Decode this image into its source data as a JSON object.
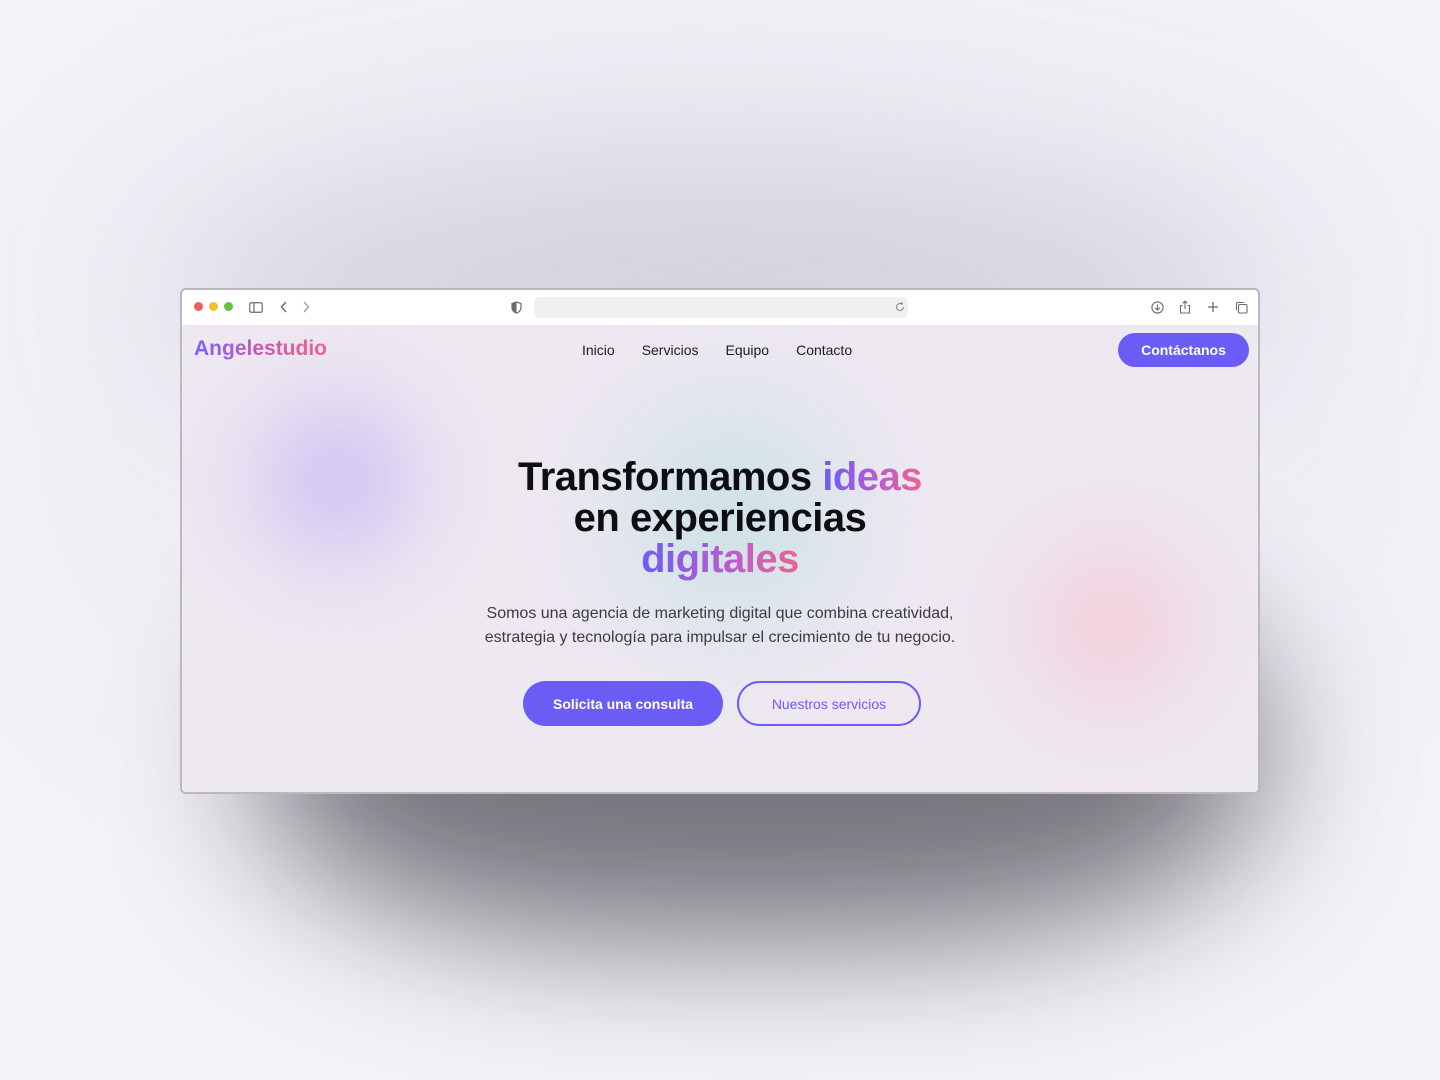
{
  "browser": {
    "url": ""
  },
  "site": {
    "logo": "Angelestudio",
    "nav": [
      "Inicio",
      "Servicios",
      "Equipo",
      "Contacto"
    ],
    "cta": "Contáctanos"
  },
  "hero": {
    "line1_a": "Transformamos ",
    "line1_b": "ideas",
    "line2": "en experiencias",
    "line3": "digitales",
    "subtitle_1": "Somos una agencia de marketing digital que combina creatividad,",
    "subtitle_2": "estrategia y tecnología para impulsar el crecimiento de tu negocio.",
    "primary_button": "Solicita una consulta",
    "secondary_button": "Nuestros servicios"
  },
  "colors": {
    "accent": "#6b5cf6",
    "gradient_end": "#f06292"
  }
}
